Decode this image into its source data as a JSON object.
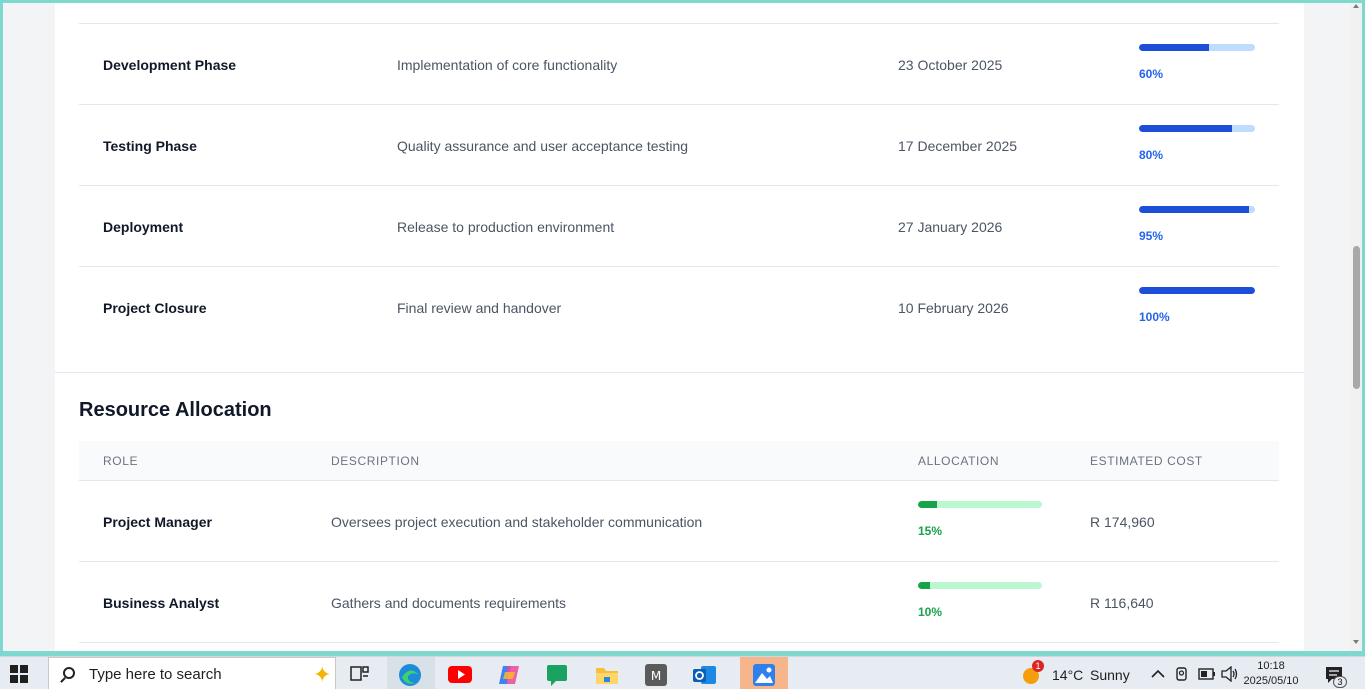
{
  "milestones": {
    "rows": [
      {
        "name": "Development Phase",
        "description": "Implementation of core functionality",
        "date": "23 October 2025",
        "progress_label": "60%",
        "progress": 60
      },
      {
        "name": "Testing Phase",
        "description": "Quality assurance and user acceptance testing",
        "date": "17 December 2025",
        "progress_label": "80%",
        "progress": 80
      },
      {
        "name": "Deployment",
        "description": "Release to production environment",
        "date": "27 January 2026",
        "progress_label": "95%",
        "progress": 95
      },
      {
        "name": "Project Closure",
        "description": "Final review and handover",
        "date": "10 February 2026",
        "progress_label": "100%",
        "progress": 100
      }
    ]
  },
  "resource_allocation": {
    "title": "Resource Allocation",
    "headers": {
      "role": "ROLE",
      "description": "DESCRIPTION",
      "allocation": "ALLOCATION",
      "cost": "ESTIMATED COST"
    },
    "rows": [
      {
        "role": "Project Manager",
        "description": "Oversees project execution and stakeholder communication",
        "allocation_label": "15%",
        "allocation": 15,
        "cost": "R 174,960"
      },
      {
        "role": "Business Analyst",
        "description": "Gathers and documents requirements",
        "allocation_label": "10%",
        "allocation": 10,
        "cost": "R 116,640"
      }
    ]
  },
  "taskbar": {
    "search_placeholder": "Type here to search",
    "weather_temp": "14°C",
    "weather_text": "Sunny",
    "weather_badge": "1",
    "time": "10:18",
    "date": "2025/05/10",
    "notification_count": "3"
  },
  "colors": {
    "accent_blue": "#1d4ed8",
    "accent_green": "#16a34a",
    "frame": "#7fd8d0"
  }
}
